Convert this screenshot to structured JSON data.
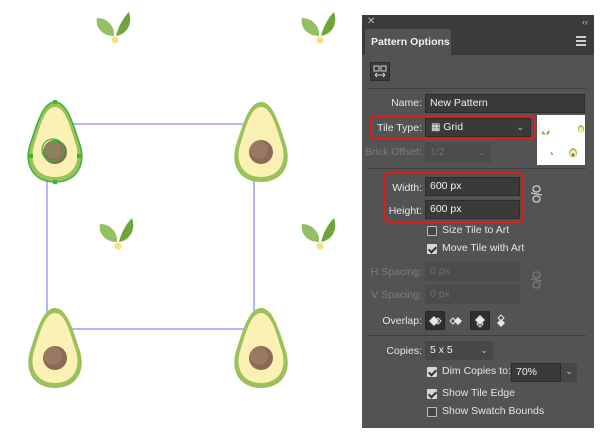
{
  "panel": {
    "title": "Pattern Options",
    "name": {
      "label": "Name:",
      "value": "New Pattern"
    },
    "tile_type": {
      "label": "Tile Type:",
      "value": "Grid"
    },
    "brick_offset": {
      "label": "Brick Offset:",
      "value": "1/2"
    },
    "width": {
      "label": "Width:",
      "value": "600 px"
    },
    "height": {
      "label": "Height:",
      "value": "600 px"
    },
    "size_tile_to_art": {
      "label": "Size Tile to Art",
      "checked": false
    },
    "move_tile_with_art": {
      "label": "Move Tile with Art",
      "checked": true
    },
    "h_spacing": {
      "label": "H Spacing:",
      "value": "0 px"
    },
    "v_spacing": {
      "label": "V Spacing:",
      "value": "0 px"
    },
    "overlap": {
      "label": "Overlap:"
    },
    "copies": {
      "label": "Copies:",
      "value": "5 x 5"
    },
    "dim_copies": {
      "label": "Dim Copies to:",
      "checked": true,
      "value": "70%"
    },
    "show_tile_edge": {
      "label": "Show Tile Edge",
      "checked": true
    },
    "show_swatch_bounds": {
      "label": "Show Swatch Bounds",
      "checked": false
    }
  },
  "colors": {
    "panel_bg": "#535353",
    "highlight": "#e21b1b",
    "tile_edge": "#6b6bff",
    "avocado_skin": "#9cc15a",
    "avocado_flesh": "#fbf1b4",
    "avocado_pit": "#8a6a55",
    "leaf": "#7ab648"
  }
}
